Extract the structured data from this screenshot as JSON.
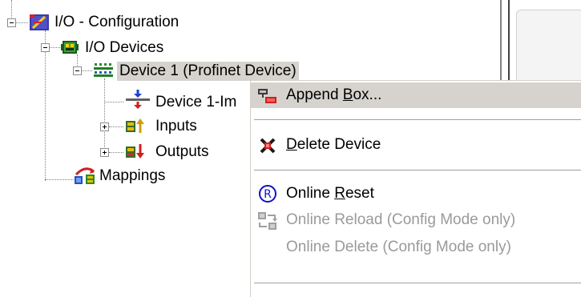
{
  "tree": {
    "root": {
      "label": "I/O - Configuration"
    },
    "devices": {
      "label": "I/O Devices"
    },
    "device1": {
      "label": "Device 1 (Profinet Device)"
    },
    "device1_image": {
      "label": "Device 1-Im"
    },
    "inputs": {
      "label": "Inputs"
    },
    "outputs": {
      "label": "Outputs"
    },
    "mappings": {
      "label": "Mappings"
    }
  },
  "context_menu": {
    "append_box": {
      "pre": "Append ",
      "key": "B",
      "post": "ox..."
    },
    "delete_device": {
      "pre": "",
      "key": "D",
      "post": "elete Device"
    },
    "online_reset": {
      "pre": "Online ",
      "key": "R",
      "post": "eset"
    },
    "online_reload": {
      "label": "Online Reload (Config Mode only)"
    },
    "online_delete": {
      "label": "Online Delete (Config Mode only)"
    }
  },
  "colors": {
    "selection": "#d6d3ce",
    "disabled_text": "#9a9a9a",
    "reset_icon": "#1010c8",
    "delete_icon": "#c00000"
  }
}
